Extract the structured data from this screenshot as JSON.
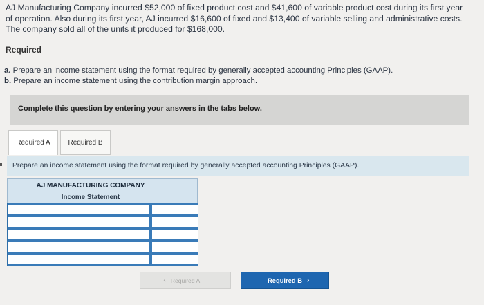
{
  "problem": {
    "line1": "AJ Manufacturing Company incurred $52,000 of fixed product cost and $41,600 of variable product cost during its first year",
    "line2": "of operation. Also during its first year, AJ incurred $16,600 of fixed and $13,400 of variable selling and administrative costs.",
    "line3": "The company sold all of the units it produced for $168,000."
  },
  "required_heading": "Required",
  "tasks": [
    {
      "letter": "a.",
      "text": "Prepare an income statement using the format required by generally accepted accounting Principles (GAAP)."
    },
    {
      "letter": "b.",
      "text": "Prepare an income statement using the contribution margin approach."
    }
  ],
  "instruction": "Complete this question by entering your answers in the tabs below.",
  "tabs": [
    {
      "label": "Required A",
      "active": true
    },
    {
      "label": "Required B",
      "active": false
    }
  ],
  "prompt": "Prepare an income statement using the format required by generally accepted accounting Principles (GAAP).",
  "statement": {
    "company": "AJ MANUFACTURING COMPANY",
    "title": "Income Statement",
    "rows": [
      {
        "label": "",
        "amount": ""
      },
      {
        "label": "",
        "amount": ""
      },
      {
        "label": "",
        "amount": ""
      },
      {
        "label": "",
        "amount": ""
      },
      {
        "label": "",
        "amount": ""
      }
    ]
  },
  "nav": {
    "prev_label": "Required A",
    "next_label": "Required B",
    "prev_icon": "chevron-left-icon",
    "next_icon": "chevron-right-icon"
  },
  "colors": {
    "accent": "#1e66b0",
    "header_bg": "#d5e4ef",
    "prompt_bg": "#d9e7ee"
  }
}
